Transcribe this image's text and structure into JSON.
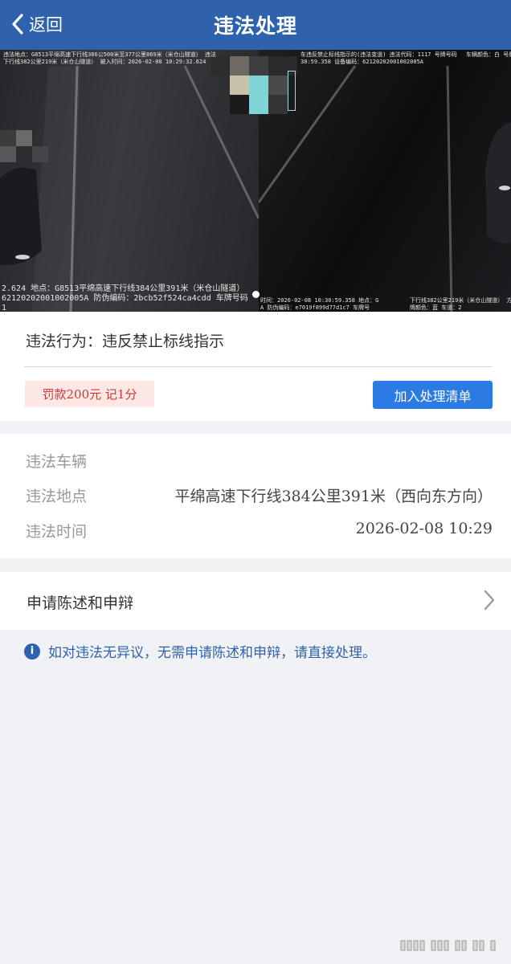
{
  "header": {
    "back_label": "返回",
    "title": "违法处理"
  },
  "photo": {
    "left_stamp_top_1": "违法地点：G8513平绵高速下行线386公500米至377公里869米（米仓山隧道） 违法",
    "left_stamp_top_2": "下行线382公里219米（米仓山隧道） 被入时间：2026-02-08 10:29:32.624 ",
    "left_stamp_bottom_1": "2.624 地点：G8513平绵高速下行线384公里391米（米仓山隧道）",
    "left_stamp_bottom_2": "62120202001002005A 防伪编码：2bcb52f524ca4cdd 车牌号码",
    "left_stamp_bottom_3": "1",
    "right_stamp_top_1": "车违反禁止标线指示的(违法变道) 违法代码：1117 号牌号码",
    "right_stamp_top_2": "30:59.358 设备编码：62120202001002005A",
    "right_stamp_top_3": "车辆颜色：白 号牌",
    "right_stamp_bottom_1": "时间：2026-02-08 10:30:59.358 地点：G",
    "right_stamp_bottom_2": "A 防伪编码：e7019f899d77d1c7 车牌号",
    "right_stamp_bottom_3": "下行线382公里219米（米仓山隧道） 方向",
    "right_stamp_bottom_4": "牌颜色：蓝 车道：2"
  },
  "violation": {
    "behavior_label": "违法行为：",
    "behavior_value": "违反禁止标线指示",
    "fine_tag": "罚款200元 记1分",
    "add_button": "加入处理清单"
  },
  "details": {
    "vehicle_label": "违法车辆",
    "vehicle_value": "",
    "location_label": "违法地点",
    "location_value": "平绵高速下行线384公里391米（西向东方向）",
    "time_label": "违法时间",
    "time_value": "2026-02-08 10:29"
  },
  "appeal": {
    "label": "申请陈述和申辩"
  },
  "notice": {
    "text": "如对违法无异议，无需申请陈述和申辩，请直接处理。"
  },
  "colors": {
    "header_bg": "#2f62ad",
    "button_bg": "#2c7be5",
    "fine_bg": "#fde8e6",
    "fine_text": "#c8393a"
  },
  "icons": [
    "chevron-left-icon",
    "info-icon",
    "chevron-right-icon"
  ]
}
